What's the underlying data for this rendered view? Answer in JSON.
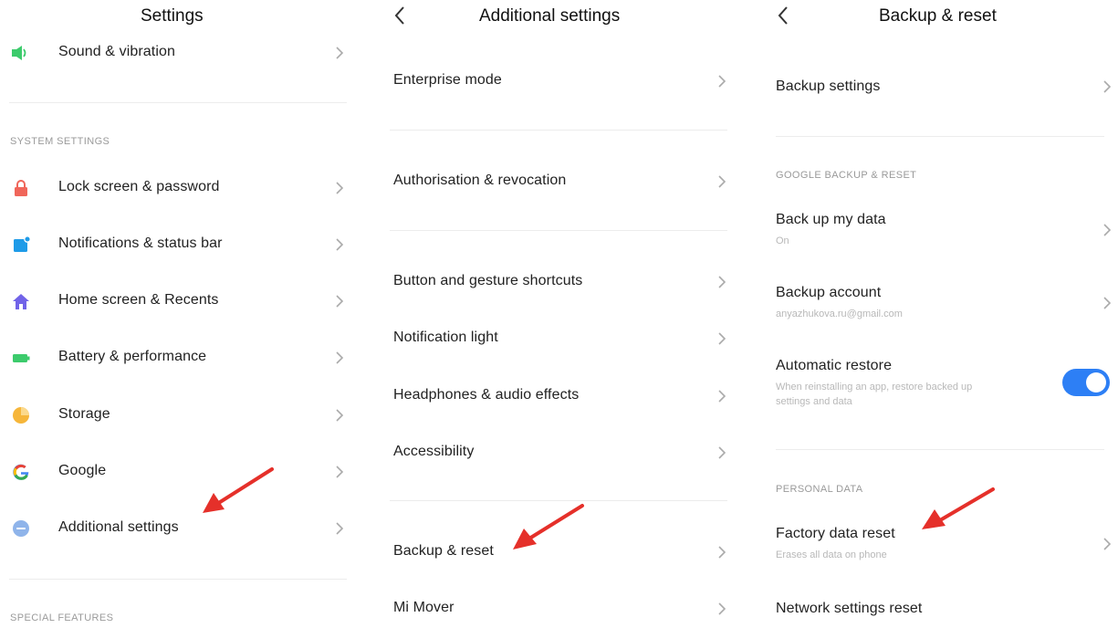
{
  "settings": {
    "title": "Settings",
    "sound_label": "Sound & vibration",
    "system_section": "SYSTEM SETTINGS",
    "items": [
      {
        "label": "Lock screen & password",
        "icon": "lock-icon",
        "color": "#f0665a"
      },
      {
        "label": "Notifications & status bar",
        "icon": "notification-icon",
        "color": "#1e9be8"
      },
      {
        "label": "Home screen & Recents",
        "icon": "home-icon",
        "color": "#7163e8"
      },
      {
        "label": "Battery & performance",
        "icon": "battery-icon",
        "color": "#3ccb6c"
      },
      {
        "label": "Storage",
        "icon": "storage-pie-icon",
        "color": "#f6b63a"
      },
      {
        "label": "Google",
        "icon": "google-icon",
        "color": "#4285f4"
      },
      {
        "label": "Additional settings",
        "icon": "more-dots-icon",
        "color": "#8fb4ea"
      }
    ],
    "special_section": "SPECIAL FEATURES"
  },
  "additional": {
    "title": "Additional settings",
    "items": [
      {
        "label": "Enterprise mode"
      },
      {
        "label": "Authorisation & revocation"
      },
      {
        "label": "Button and gesture shortcuts"
      },
      {
        "label": "Notification light"
      },
      {
        "label": "Headphones & audio effects"
      },
      {
        "label": "Accessibility"
      },
      {
        "label": "Backup & reset"
      },
      {
        "label": "Mi Mover"
      }
    ]
  },
  "backup": {
    "title": "Backup & reset",
    "backup_settings": "Backup settings",
    "google_section": "GOOGLE BACKUP & RESET",
    "back_up_data": {
      "label": "Back up my data",
      "sub": "On"
    },
    "backup_account": {
      "label": "Backup account",
      "sub": "anyazhukova.ru@gmail.com"
    },
    "auto_restore": {
      "label": "Automatic restore",
      "sub_line1": "When reinstalling an app, restore backed up",
      "sub_line2": "settings and data",
      "enabled": true
    },
    "personal_section": "PERSONAL DATA",
    "factory_reset": {
      "label": "Factory data reset",
      "sub": "Erases all data on phone"
    },
    "network_reset": {
      "label": "Network settings reset"
    }
  },
  "colors": {
    "accent": "#2d7ff5",
    "annotation_arrow": "#e5302a"
  }
}
